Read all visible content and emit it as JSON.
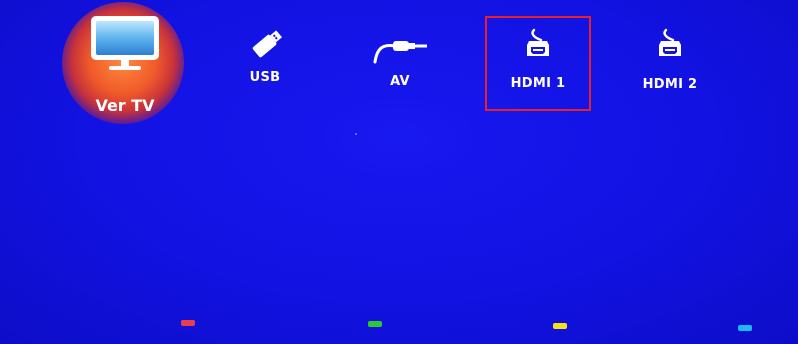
{
  "sources": {
    "tv": {
      "label": "Ver TV",
      "icon": "tv-icon",
      "selected": true
    },
    "usb": {
      "label": "USB",
      "icon": "usb-icon"
    },
    "av": {
      "label": "AV",
      "icon": "av-cable-icon"
    },
    "hdmi1": {
      "label": "HDMI 1",
      "icon": "hdmi-icon",
      "focused": true
    },
    "hdmi2": {
      "label": "HDMI 2",
      "icon": "hdmi-icon"
    }
  },
  "color_keys": [
    {
      "name": "red",
      "color": "#e8404a"
    },
    {
      "name": "green",
      "color": "#2ec832"
    },
    {
      "name": "yellow",
      "color": "#f2e218"
    },
    {
      "name": "blue",
      "color": "#20b8f0"
    }
  ],
  "colors": {
    "background": "#1212e2",
    "focus_frame": "#e8202a",
    "selection_glow": "#f05a2a",
    "text": "#ffffff"
  }
}
